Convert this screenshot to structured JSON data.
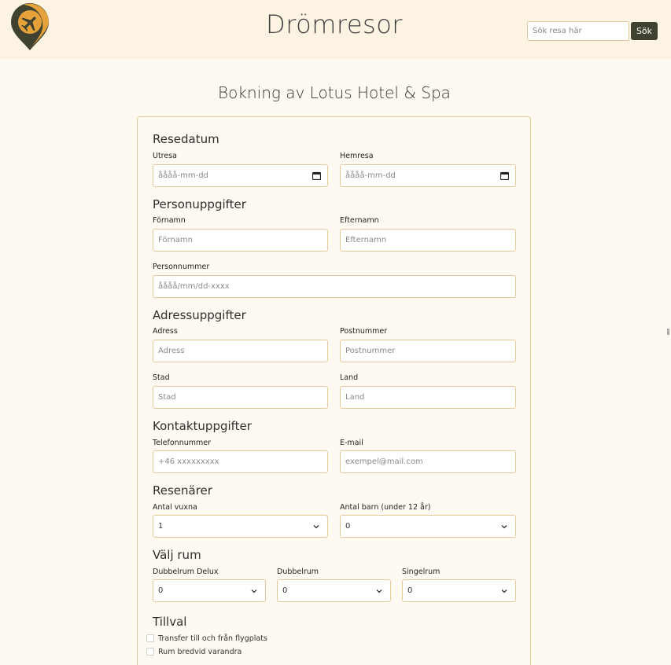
{
  "header": {
    "site_title": "Drömresor",
    "search_placeholder": "Sök resa här",
    "search_button": "Sök",
    "colors": {
      "background": "#fdf3e3",
      "logo_orange": "#e5a23b",
      "logo_dark": "#3f4230"
    },
    "logo_icon": "airplane-pin-icon"
  },
  "page": {
    "title": "Bokning av Lotus Hotel & Spa"
  },
  "sections": {
    "dates": {
      "heading": "Resedatum",
      "departure_label": "Utresa",
      "departure_placeholder": "åååå-mm-dd",
      "return_label": "Hemresa",
      "return_placeholder": "åååå-mm-dd"
    },
    "personal": {
      "heading": "Personuppgifter",
      "first_name_label": "Förnamn",
      "first_name_placeholder": "Förnamn",
      "last_name_label": "Efternamn",
      "last_name_placeholder": "Efternamn",
      "ssn_label": "Personnummer",
      "ssn_placeholder": "åååå/mm/dd-xxxx"
    },
    "address": {
      "heading": "Adressuppgifter",
      "street_label": "Adress",
      "street_placeholder": "Adress",
      "zip_label": "Postnummer",
      "zip_placeholder": "Postnummer",
      "city_label": "Stad",
      "city_placeholder": "Stad",
      "country_label": "Land",
      "country_placeholder": "Land"
    },
    "contact": {
      "heading": "Kontaktuppgifter",
      "phone_label": "Telefonnummer",
      "phone_placeholder": "+46 xxxxxxxxx",
      "email_label": "E-mail",
      "email_placeholder": "exempel@mail.com"
    },
    "travelers": {
      "heading": "Resenärer",
      "adults_label": "Antal vuxna",
      "adults_value": "1",
      "children_label": "Antal barn (under 12 år)",
      "children_value": "0"
    },
    "rooms": {
      "heading": "Välj rum",
      "deluxe_label": "Dubbelrum Delux",
      "deluxe_value": "0",
      "double_label": "Dubbelrum",
      "double_value": "0",
      "single_label": "Singelrum",
      "single_value": "0"
    },
    "extras": {
      "heading": "Tillval",
      "options": [
        "Transfer till och från flygplats",
        "Rum bredvid varandra"
      ]
    }
  }
}
